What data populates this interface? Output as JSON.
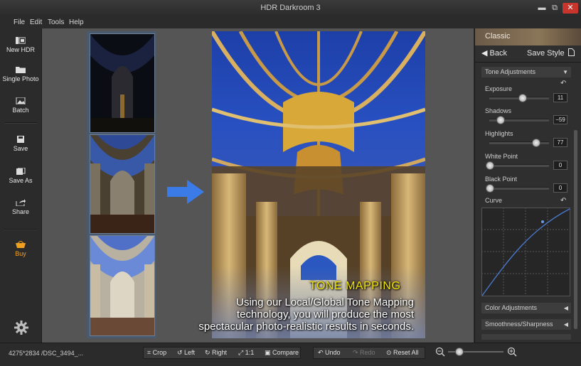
{
  "window": {
    "title": "HDR Darkroom 3",
    "minimize": "▬",
    "maximize": "⧉",
    "close": "✕"
  },
  "menu": [
    "File",
    "Edit",
    "Tools",
    "Help"
  ],
  "left_toolbar": {
    "new_hdr": "New HDR",
    "single_photo": "Single Photo",
    "batch": "Batch",
    "save": "Save",
    "save_as": "Save As",
    "share": "Share",
    "buy": "Buy"
  },
  "arrow_color": "#3a7be8",
  "overlay": {
    "heading": "TONE MAPPING",
    "line1": "Using our Local/Global Tone Mapping",
    "line2": "technology, you will produce the most",
    "line3": "spectacular photo-realistic results in seconds."
  },
  "right_panel": {
    "preset": "Classic",
    "back": "Back",
    "save_style": "Save Style",
    "tone_section": "Tone Adjustments",
    "sliders": [
      {
        "label": "Exposure",
        "value": "11",
        "level": 0.62
      },
      {
        "label": "Shadows",
        "value": "−59",
        "level": 0.2
      },
      {
        "label": "Highlights",
        "value": "77",
        "level": 0.88
      },
      {
        "label": "White Point",
        "value": "0",
        "level": 0.0
      },
      {
        "label": "Black Point",
        "value": "0",
        "level": 0.0
      }
    ],
    "curve": "Curve",
    "color_section": "Color Adjustments",
    "sharp_section": "Smoothness/Sharpness"
  },
  "bottom": {
    "status": "4275*2834 /DSC_3494_...",
    "crop": "Crop",
    "left": "Left",
    "right": "Right",
    "one_to_one": "1:1",
    "compare": "Compare",
    "undo": "Undo",
    "redo": "Redo",
    "reset_all": "Reset All",
    "zoom_level": 0.15
  }
}
